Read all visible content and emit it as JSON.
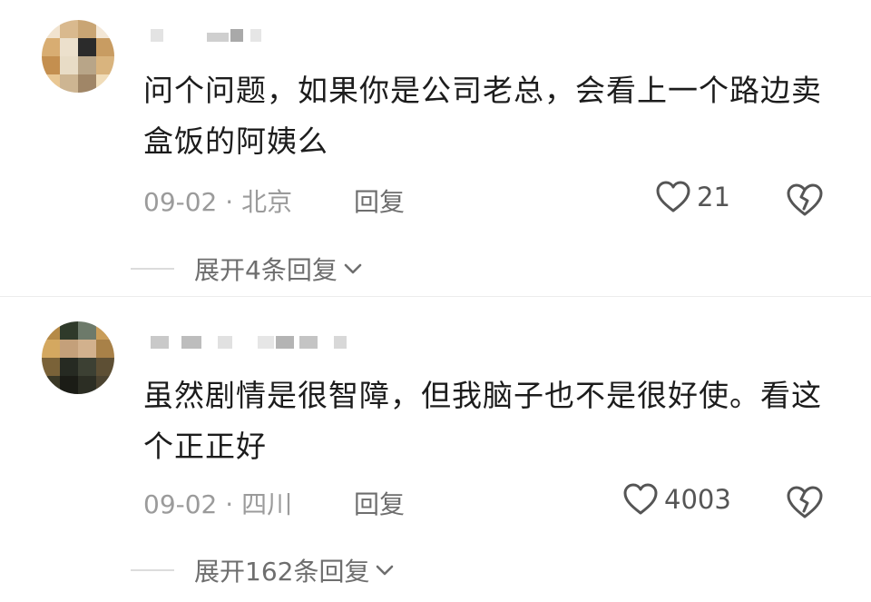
{
  "comments": [
    {
      "text": "问个问题，如果你是公司老总，会看上一个路边卖盒饭的阿姨么",
      "date_location": "09-02 · 北京",
      "reply_label": "回复",
      "like_count": "21",
      "expand_label": "展开4条回复"
    },
    {
      "text": "虽然剧情是很智障，但我脑子也不是很好使。看这个正正好",
      "date_location": "09-02 · 四川",
      "reply_label": "回复",
      "like_count": "4003",
      "expand_label": "展开162条回复"
    }
  ],
  "icons": {
    "like": "heart-outline-icon",
    "dislike": "broken-heart-icon",
    "expand": "chevron-down-icon"
  },
  "colors": {
    "text": "#1c1c1c",
    "meta": "#9b9b9b",
    "action": "#6e6e6e"
  }
}
